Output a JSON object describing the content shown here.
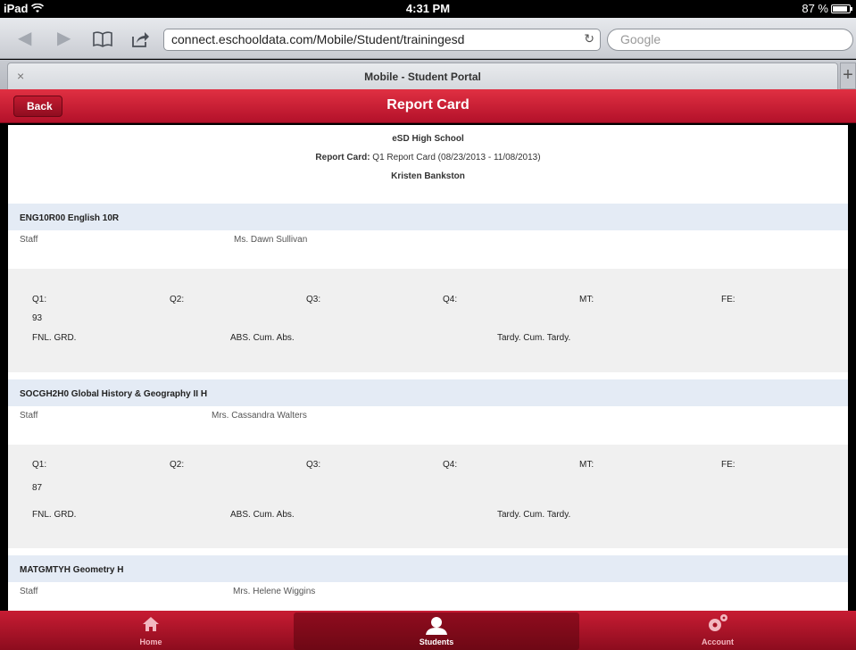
{
  "status": {
    "device": "iPad",
    "time": "4:31 PM",
    "battery": "87 %"
  },
  "browser": {
    "url": "connect.eschooldata.com/Mobile/Student/trainingesd",
    "search_placeholder": "Google",
    "tab_title": "Mobile - Student Portal",
    "tab_close": "×",
    "tab_add": "+"
  },
  "header": {
    "back_label": "Back",
    "title": "Report Card"
  },
  "report": {
    "school": "eSD High School",
    "card_label": "Report Card:",
    "card_value": " Q1 Report Card (08/23/2013 - 11/08/2013)",
    "student": "Kristen Bankston"
  },
  "grade_headers": [
    "Q1:",
    "Q2:",
    "Q3:",
    "Q4:",
    "MT:",
    "FE:"
  ],
  "row_labels": {
    "staff": "Staff",
    "final": "FNL. GRD.",
    "absences": "ABS. Cum. Abs.",
    "tardy": "Tardy. Cum. Tardy."
  },
  "courses": [
    {
      "title": "ENG10R00 English 10R",
      "teacher": "Ms. Dawn Sullivan",
      "q1": "93"
    },
    {
      "title": "SOCGH2H0 Global History & Geography II H",
      "teacher": "Mrs. Cassandra Walters",
      "q1": "87"
    },
    {
      "title": "MATGMTYH Geometry H",
      "teacher": "Mrs. Helene Wiggins"
    }
  ],
  "nav": {
    "home": "Home",
    "students": "Students",
    "account": "Account"
  },
  "colors": {
    "brand_red": "#c4172e",
    "course_header_bg": "#e4ebf5"
  }
}
